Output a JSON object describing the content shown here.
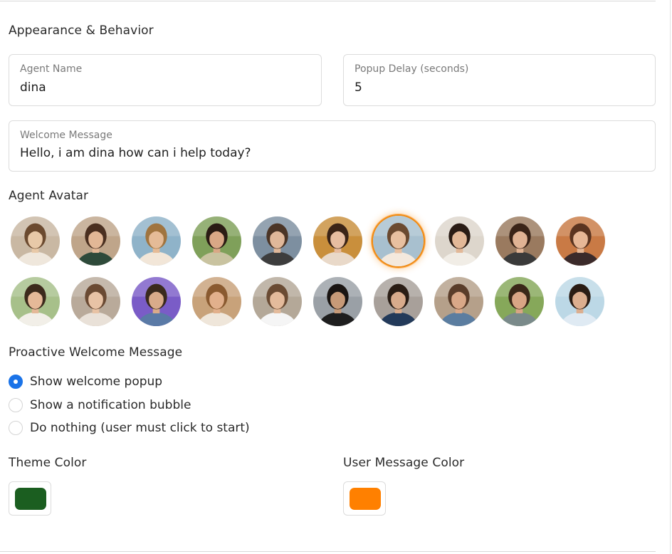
{
  "section": {
    "title": "Appearance & Behavior"
  },
  "fields": {
    "agent_name": {
      "label": "Agent Name",
      "value": "dina"
    },
    "popup_delay": {
      "label": "Popup Delay (seconds)",
      "value": "5"
    },
    "welcome_message": {
      "label": "Welcome Message",
      "value": "Hello, i am dina how can i help today?"
    }
  },
  "avatars": {
    "title": "Agent Avatar",
    "selected_index": 6,
    "row1": [
      {
        "icon": "avatar-woman-city-street"
      },
      {
        "icon": "avatar-woman-cafe-street"
      },
      {
        "icon": "avatar-woman-beach"
      },
      {
        "icon": "avatar-woman-garden"
      },
      {
        "icon": "avatar-woman-city-glass"
      },
      {
        "icon": "avatar-woman-arcade"
      },
      {
        "icon": "avatar-woman-seaside-selected"
      },
      {
        "icon": "avatar-woman-sofa"
      },
      {
        "icon": "avatar-woman-coffee-cafe"
      },
      {
        "icon": "avatar-woman-sunset-city"
      }
    ],
    "row2": [
      {
        "icon": "avatar-woman-juice"
      },
      {
        "icon": "avatar-woman-street-smile"
      },
      {
        "icon": "avatar-woman-graffiti"
      },
      {
        "icon": "avatar-woman-curly"
      },
      {
        "icon": "avatar-woman-phone"
      },
      {
        "icon": "avatar-man-gym"
      },
      {
        "icon": "avatar-man-suit"
      },
      {
        "icon": "avatar-man-coffee"
      },
      {
        "icon": "avatar-man-park"
      },
      {
        "icon": "avatar-man-beach"
      }
    ]
  },
  "proactive": {
    "title": "Proactive Welcome Message",
    "options": [
      {
        "label": "Show welcome popup",
        "checked": true
      },
      {
        "label": "Show a notification bubble",
        "checked": false
      },
      {
        "label": "Do nothing (user must click to start)",
        "checked": false
      }
    ]
  },
  "colors": {
    "theme": {
      "label": "Theme Color",
      "value": "#1b5e20"
    },
    "user_message": {
      "label": "User Message Color",
      "value": "#ff8000"
    },
    "radio_accent": "#1a73e8",
    "selected_ring": "#f08a12"
  }
}
